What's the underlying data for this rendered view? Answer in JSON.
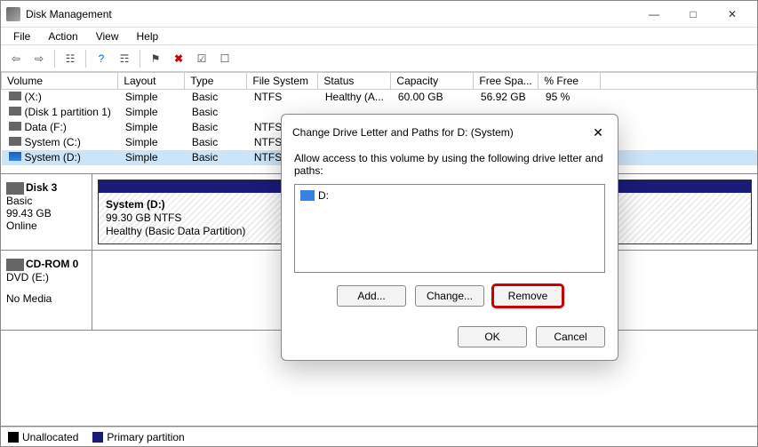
{
  "app": {
    "title": "Disk Management"
  },
  "menu": [
    "File",
    "Action",
    "View",
    "Help"
  ],
  "columns": [
    "Volume",
    "Layout",
    "Type",
    "File System",
    "Status",
    "Capacity",
    "Free Spa...",
    "% Free"
  ],
  "colwidths": [
    "127px",
    "75px",
    "70px",
    "80px",
    "80px",
    "93px",
    "73px",
    "70px"
  ],
  "volumes": [
    {
      "name": "(X:)",
      "layout": "Simple",
      "type": "Basic",
      "fs": "NTFS",
      "status": "Healthy (A...",
      "capacity": "60.00 GB",
      "free": "56.92 GB",
      "pct": "95 %",
      "selected": false
    },
    {
      "name": "(Disk 1 partition 1)",
      "layout": "Simple",
      "type": "Basic",
      "fs": "",
      "status": "",
      "capacity": "",
      "free": "",
      "pct": "",
      "selected": false
    },
    {
      "name": "Data (F:)",
      "layout": "Simple",
      "type": "Basic",
      "fs": "NTFS",
      "status": "",
      "capacity": "",
      "free": "",
      "pct": "",
      "selected": false
    },
    {
      "name": "System (C:)",
      "layout": "Simple",
      "type": "Basic",
      "fs": "NTFS",
      "status": "",
      "capacity": "",
      "free": "",
      "pct": "",
      "selected": false
    },
    {
      "name": "System (D:)",
      "layout": "Simple",
      "type": "Basic",
      "fs": "NTFS",
      "status": "",
      "capacity": "",
      "free": "",
      "pct": "",
      "selected": true
    }
  ],
  "disk3": {
    "name": "Disk 3",
    "type": "Basic",
    "size": "99.43 GB",
    "status": "Online",
    "partition": {
      "name": "System  (D:)",
      "info1": "99.30 GB NTFS",
      "info2": "Healthy (Basic Data Partition)"
    }
  },
  "cdrom": {
    "name": "CD-ROM 0",
    "sub": "DVD (E:)",
    "status": "No Media"
  },
  "legend": {
    "unalloc": "Unallocated",
    "primary": "Primary partition"
  },
  "dialog": {
    "title": "Change Drive Letter and Paths for D: (System)",
    "message": "Allow access to this volume by using the following drive letter and paths:",
    "drive": "D:",
    "add": "Add...",
    "change": "Change...",
    "remove": "Remove",
    "ok": "OK",
    "cancel": "Cancel"
  }
}
